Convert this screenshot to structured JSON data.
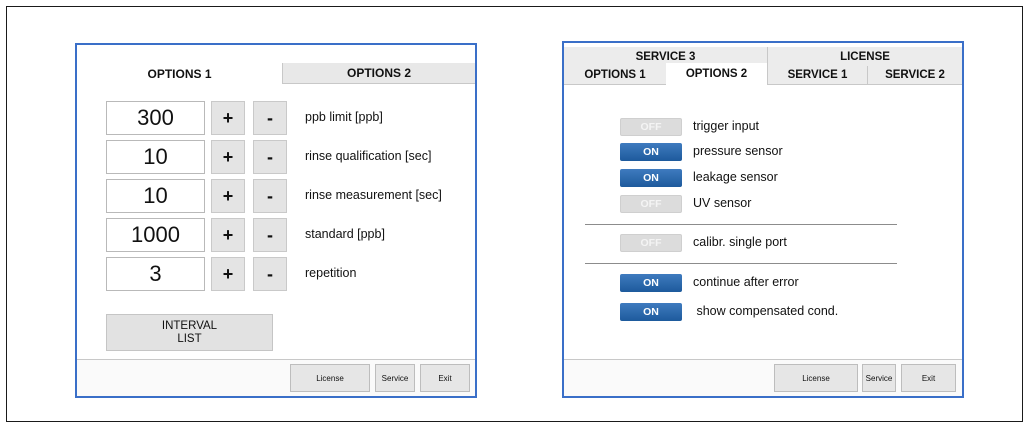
{
  "options1": {
    "tabs": [
      "OPTIONS 1",
      "OPTIONS 2"
    ],
    "rows": [
      {
        "value": "300",
        "plus": "+",
        "minus": "-",
        "label": "ppb limit [ppb]"
      },
      {
        "value": "10",
        "plus": "+",
        "minus": "-",
        "label": "rinse qualification [sec]"
      },
      {
        "value": "10",
        "plus": "+",
        "minus": "-",
        "label": "rinse measurement [sec]"
      },
      {
        "value": "1000",
        "plus": "+",
        "minus": "-",
        "label": "standard [ppb]"
      },
      {
        "value": "3",
        "plus": "+",
        "minus": "-",
        "label": "repetition"
      }
    ],
    "interval_line1": "INTERVAL",
    "interval_line2": "LIST",
    "footer": {
      "license": "License",
      "service": "Service",
      "exit": "Exit"
    }
  },
  "options2": {
    "tabs_top": [
      "SERVICE 3",
      "LICENSE"
    ],
    "tabs_bottom": [
      "OPTIONS 1",
      "OPTIONS 2",
      "SERVICE 1",
      "SERVICE 2"
    ],
    "toggles": [
      {
        "state": "OFF",
        "label": "trigger input"
      },
      {
        "state": "ON",
        "label": "pressure sensor"
      },
      {
        "state": "ON",
        "label": "leakage sensor"
      },
      {
        "state": "OFF",
        "label": "UV sensor"
      },
      {
        "state": "OFF",
        "label": "calibr. single port"
      },
      {
        "state": "ON",
        "label": "continue after error"
      },
      {
        "state": "ON",
        "label": " show compensated cond."
      }
    ],
    "footer": {
      "license": "License",
      "service": "Service",
      "exit": "Exit"
    }
  },
  "colors": {
    "panel_border": "#3a6fc8",
    "toggle_on": "#1d5a9c",
    "toggle_off": "#dcdcdc"
  }
}
